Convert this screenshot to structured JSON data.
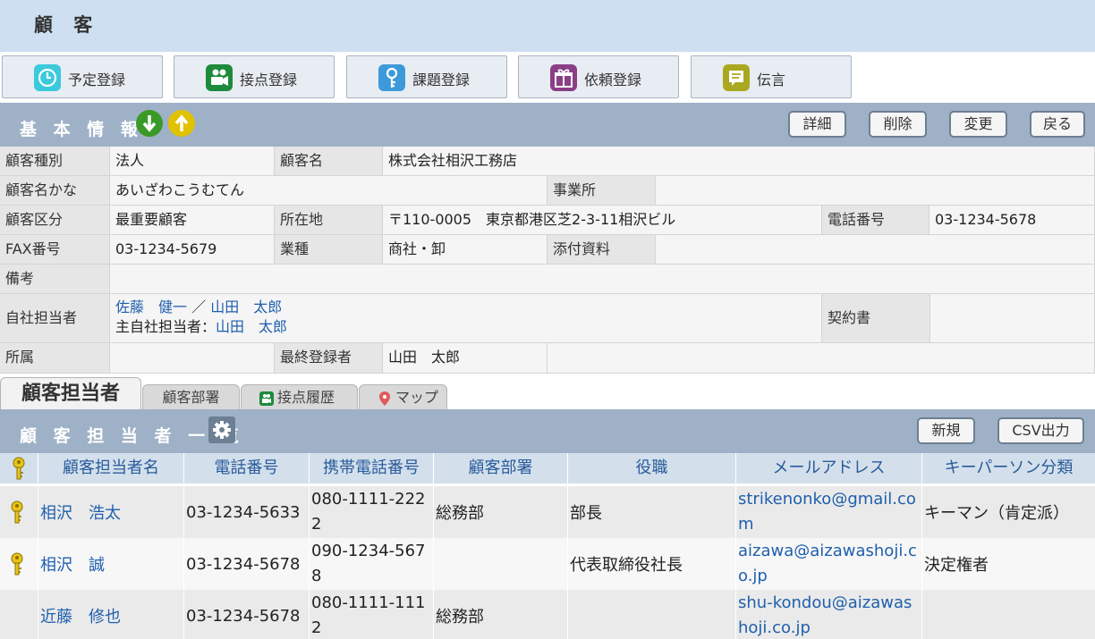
{
  "page": {
    "title": "顧 客"
  },
  "actions": [
    {
      "label": "予定登録",
      "icon": "clock-icon",
      "color": "#3bc9dd"
    },
    {
      "label": "接点登録",
      "icon": "video-camera-icon",
      "color": "#1e8a3c"
    },
    {
      "label": "課題登録",
      "icon": "key-icon",
      "color": "#3d9ad9"
    },
    {
      "label": "依頼登録",
      "icon": "gift-icon",
      "color": "#8a3e86"
    },
    {
      "label": "伝言",
      "icon": "note-icon",
      "color": "#a9a820"
    }
  ],
  "basic": {
    "title": "基 本 情 報",
    "buttons": {
      "detail": "詳細",
      "delete": "削除",
      "edit": "変更",
      "back": "戻る"
    },
    "labels": {
      "type": "顧客種別",
      "name": "顧客名",
      "kana": "顧客名かな",
      "office": "事業所",
      "category": "顧客区分",
      "address": "所在地",
      "phone": "電話番号",
      "fax": "FAX番号",
      "industry": "業種",
      "attachment": "添付資料",
      "note": "備考",
      "staff": "自社担当者",
      "contract": "契約書",
      "dept": "所属",
      "last_reg": "最終登録者"
    },
    "values": {
      "type": "法人",
      "name": "株式会社相沢工務店",
      "kana": "あいざわこうむてん",
      "office": "",
      "category": "最重要顧客",
      "address": "〒110-0005　東京都港区芝2-3-11相沢ビル",
      "phone": "03-1234-5678",
      "fax": "03-1234-5679",
      "industry": "商社・卸",
      "attachment": "",
      "note": "",
      "staff1": "佐藤　健一",
      "staff_sep": "／",
      "staff2": "山田　太郎",
      "main_staff_label": "主自社担当者：",
      "main_staff": "山田　太郎",
      "contract": "",
      "dept": "",
      "last_reg": "山田　太郎"
    }
  },
  "tabs": [
    {
      "label": "顧客担当者",
      "active": true
    },
    {
      "label": "顧客部署"
    },
    {
      "label": "接点履歴",
      "icon": "video-camera-icon"
    },
    {
      "label": "マップ",
      "icon": "map-pin-icon"
    }
  ],
  "contacts": {
    "title": "顧 客 担 当 者 一 覧",
    "buttons": {
      "new": "新規",
      "csv": "CSV出力"
    },
    "columns": [
      "顧客担当者名",
      "電話番号",
      "携帯電話番号",
      "顧客部署",
      "役職",
      "メールアドレス",
      "キーパーソン分類"
    ],
    "rows": [
      {
        "key": true,
        "name": "相沢　浩太",
        "phone": "03-1234-5633",
        "mobile": "080-1111-2222",
        "dept": "総務部",
        "position": "部長",
        "email": "strikenonko@gmail.com",
        "keyperson": "キーマン（肯定派）"
      },
      {
        "key": true,
        "name": "相沢　誠",
        "phone": "03-1234-5678",
        "mobile": "090-1234-5678",
        "dept": "",
        "position": "代表取締役社長",
        "email": "aizawa@aizawashoji.co.jp",
        "keyperson": "決定権者"
      },
      {
        "key": false,
        "name": "近藤　修也",
        "phone": "03-1234-5678",
        "mobile": "080-1111-1112",
        "dept": "総務部",
        "position": "",
        "email": "shu-kondou@aizawashoji.co.jp",
        "keyperson": ""
      }
    ]
  }
}
